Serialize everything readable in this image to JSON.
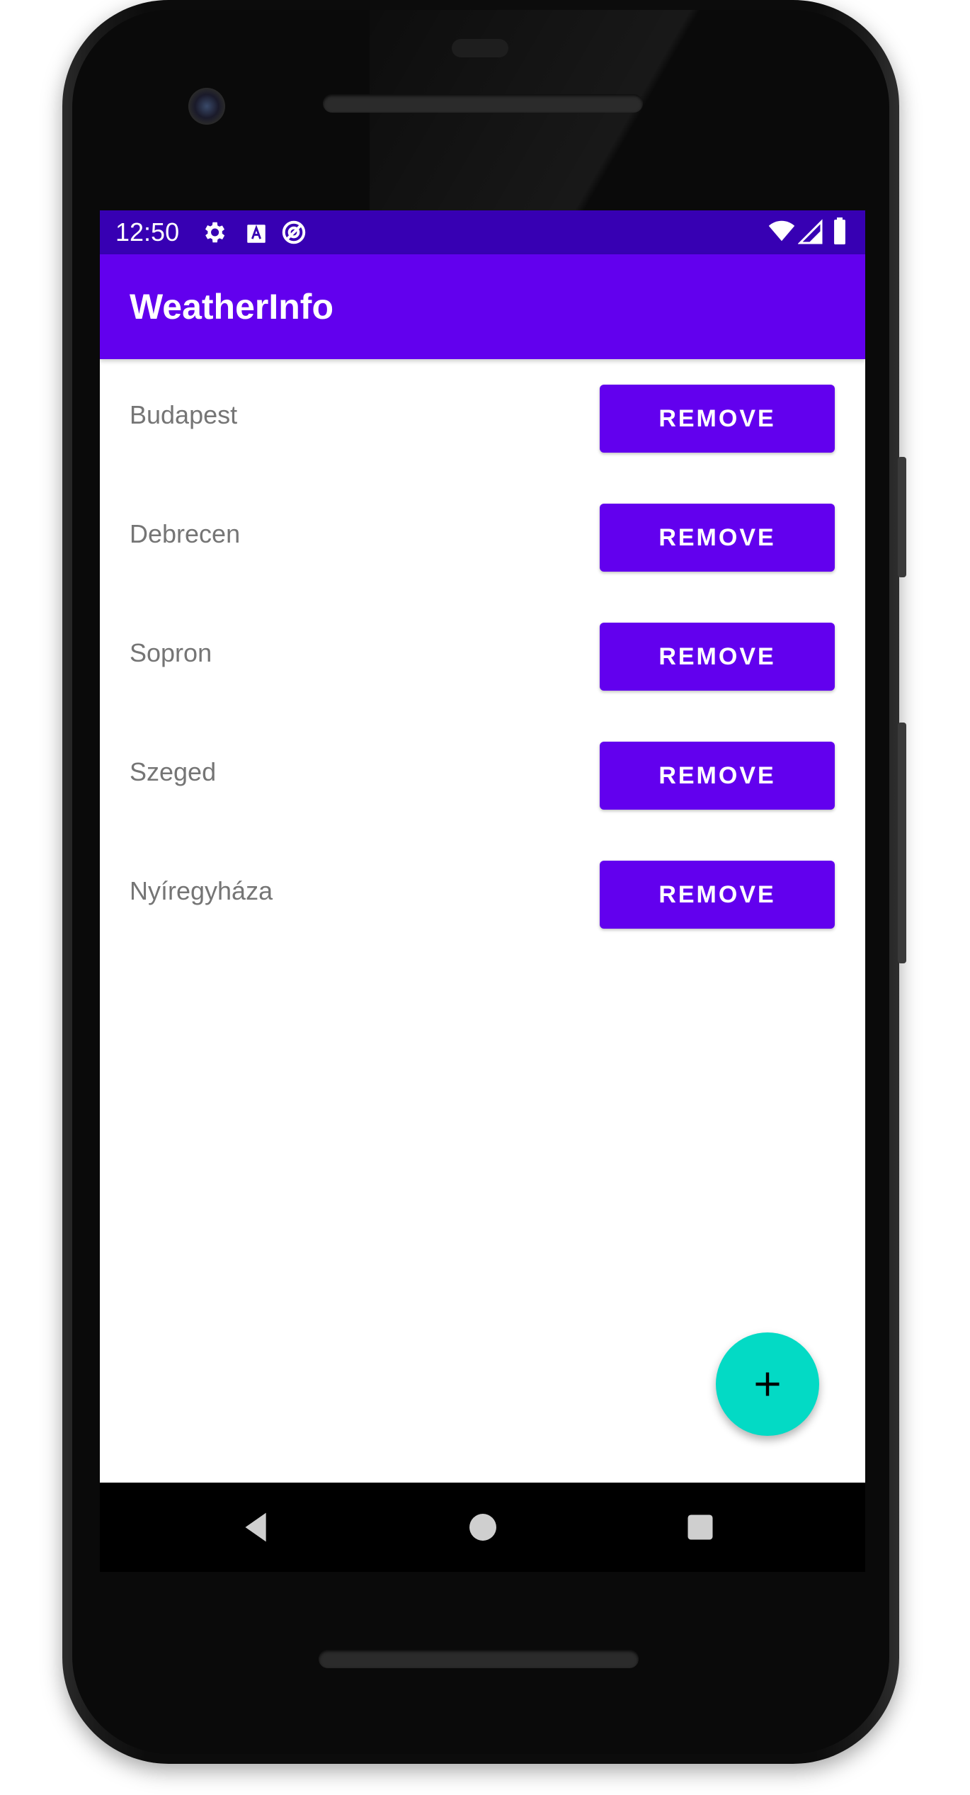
{
  "status_bar": {
    "time": "12:50",
    "icons_left": [
      "gear-icon",
      "text-a-icon",
      "data-saver-icon"
    ],
    "icons_right": [
      "wifi-icon",
      "signal-icon",
      "battery-icon"
    ],
    "background_color": "#3700b3"
  },
  "app_bar": {
    "title": "WeatherInfo",
    "background_color": "#6200ee"
  },
  "cities": [
    {
      "name": "Budapest",
      "button_label": "REMOVE"
    },
    {
      "name": "Debrecen",
      "button_label": "REMOVE"
    },
    {
      "name": "Sopron",
      "button_label": "REMOVE"
    },
    {
      "name": "Szeged",
      "button_label": "REMOVE"
    },
    {
      "name": "Nyíregyháza",
      "button_label": "REMOVE"
    }
  ],
  "fab": {
    "icon": "plus-icon",
    "color": "#03dac5"
  },
  "nav_bar": {
    "buttons": [
      "back-icon",
      "home-icon",
      "recents-icon"
    ]
  }
}
